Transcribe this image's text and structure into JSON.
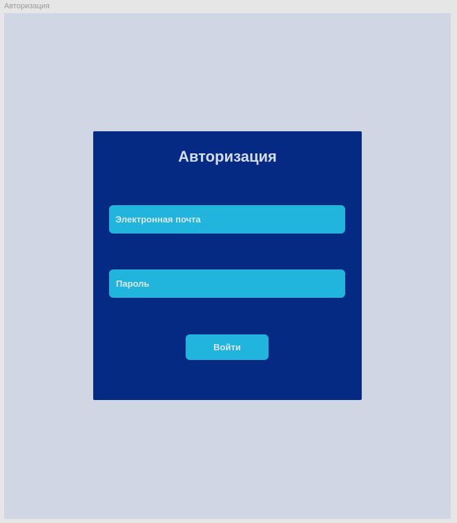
{
  "frame": {
    "label": "Авторизация"
  },
  "login_card": {
    "title": "Авторизация",
    "email_placeholder": "Электронная почта",
    "password_placeholder": "Пароль",
    "submit_label": "Войти"
  },
  "colors": {
    "page_background": "#d1d6e4",
    "card_background": "#042a83",
    "field_background": "#21b4dc",
    "title_text": "#d5dcf0"
  }
}
